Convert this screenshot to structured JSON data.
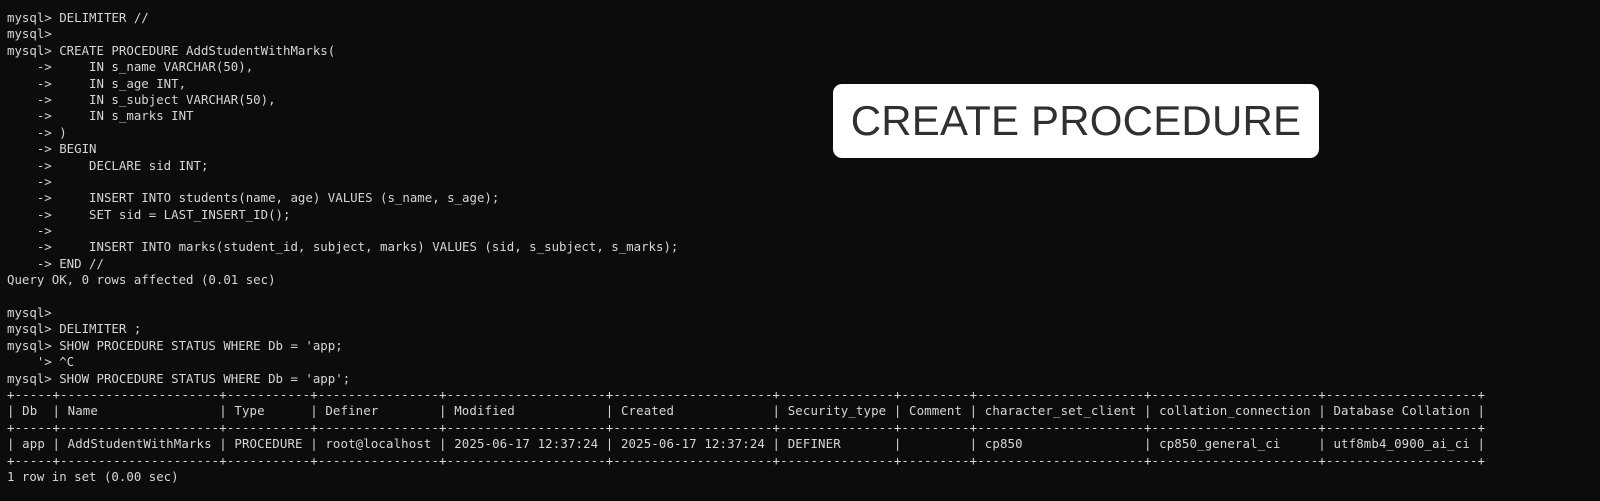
{
  "session": {
    "lines": [
      "mysql> DELIMITER //",
      "mysql>",
      "mysql> CREATE PROCEDURE AddStudentWithMarks(",
      "    ->     IN s_name VARCHAR(50),",
      "    ->     IN s_age INT,",
      "    ->     IN s_subject VARCHAR(50),",
      "    ->     IN s_marks INT",
      "    -> )",
      "    -> BEGIN",
      "    ->     DECLARE sid INT;",
      "    ->",
      "    ->     INSERT INTO students(name, age) VALUES (s_name, s_age);",
      "    ->     SET sid = LAST_INSERT_ID();",
      "    ->",
      "    ->     INSERT INTO marks(student_id, subject, marks) VALUES (sid, s_subject, s_marks);",
      "    -> END //",
      "Query OK, 0 rows affected (0.01 sec)",
      "",
      "mysql>",
      "mysql> DELIMITER ;",
      "mysql> SHOW PROCEDURE STATUS WHERE Db = 'app;",
      "    '> ^C",
      "mysql> SHOW PROCEDURE STATUS WHERE Db = 'app';"
    ],
    "table": {
      "border": "+-----+---------------------+-----------+----------------+---------------------+---------------------+---------------+---------+----------------------+----------------------+--------------------+",
      "header": "| Db  | Name                | Type      | Definer        | Modified            | Created             | Security_type | Comment | character_set_client | collation_connection | Database Collation |",
      "row": "| app | AddStudentWithMarks | PROCEDURE | root@localhost | 2025-06-17 12:37:24 | 2025-06-17 12:37:24 | DEFINER       |         | cp850                | cp850_general_ci     | utf8mb4_0900_ai_ci |"
    },
    "footer": "1 row in set (0.00 sec)"
  },
  "callout": {
    "label": "CREATE PROCEDURE"
  }
}
